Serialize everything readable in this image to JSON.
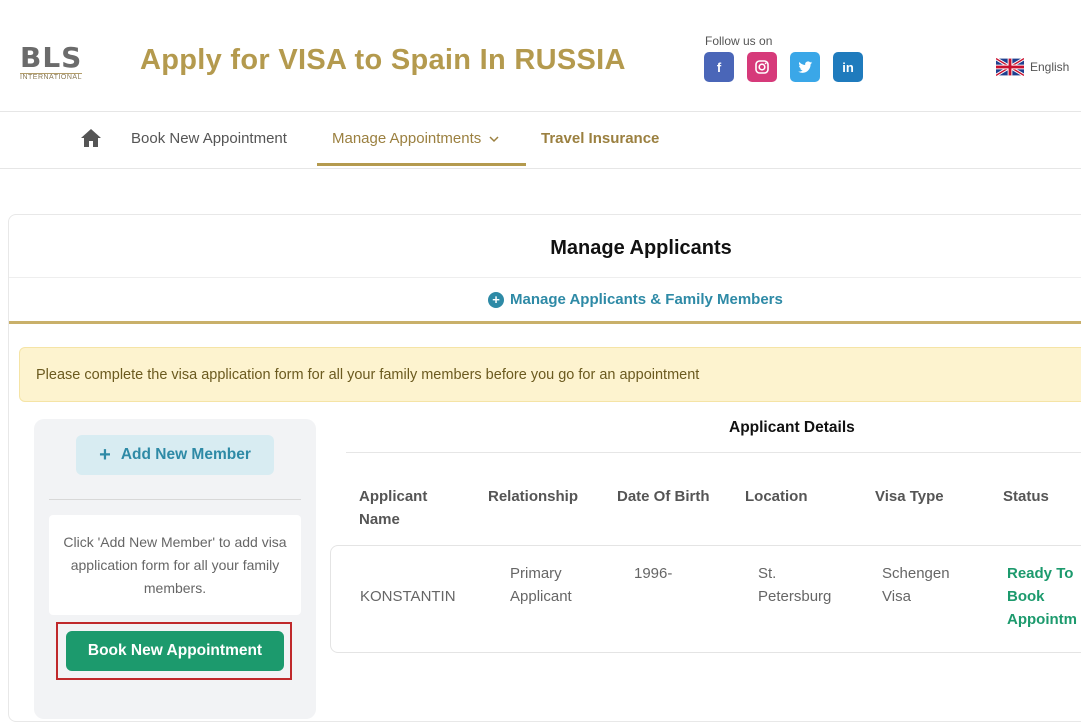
{
  "header": {
    "logo_text": "BLS",
    "logo_sub": "INTERNATIONAL",
    "title": "Apply for VISA to Spain In RUSSIA",
    "follow_label": "Follow us on",
    "socials": [
      {
        "icon": "facebook-icon",
        "glyph": "f",
        "color": "#4a66b8"
      },
      {
        "icon": "instagram-icon",
        "glyph": "◎",
        "color": "#d63a7a"
      },
      {
        "icon": "twitter-icon",
        "glyph": "🐦",
        "color": "#3aa7e8"
      },
      {
        "icon": "linkedin-icon",
        "glyph": "in",
        "color": "#1f7bbd"
      }
    ],
    "language": "English"
  },
  "nav": {
    "items": [
      "Book New Appointment",
      "Manage Appointments",
      "Travel Insurance"
    ],
    "active_index": 1
  },
  "page": {
    "title": "Manage Applicants",
    "manage_link": "Manage Applicants & Family Members",
    "alert": "Please complete the visa application form for all your family members before you go for an appointment"
  },
  "sidebar": {
    "add_button": "Add New Member",
    "info_text": "Click 'Add New Member' to add visa application form for all your family members.",
    "book_button": "Book New Appointment"
  },
  "applicants": {
    "title": "Applicant Details",
    "columns": [
      "Applicant Name",
      "Relationship",
      "Date Of Birth",
      "Location",
      "Visa Type",
      "Status"
    ],
    "rows": [
      {
        "name": "KONSTANTIN",
        "relationship": "Primary Applicant",
        "dob": "1996-",
        "location": "St. Petersburg",
        "visa_type": "Schengen Visa",
        "status": "Ready To Book Appointm"
      }
    ]
  },
  "colors": {
    "gold": "#b49a4e",
    "teal": "#2e8aa6",
    "green": "#1c9a6d",
    "alert_bg": "#fdf3cf",
    "highlight_border": "#c0292b"
  }
}
